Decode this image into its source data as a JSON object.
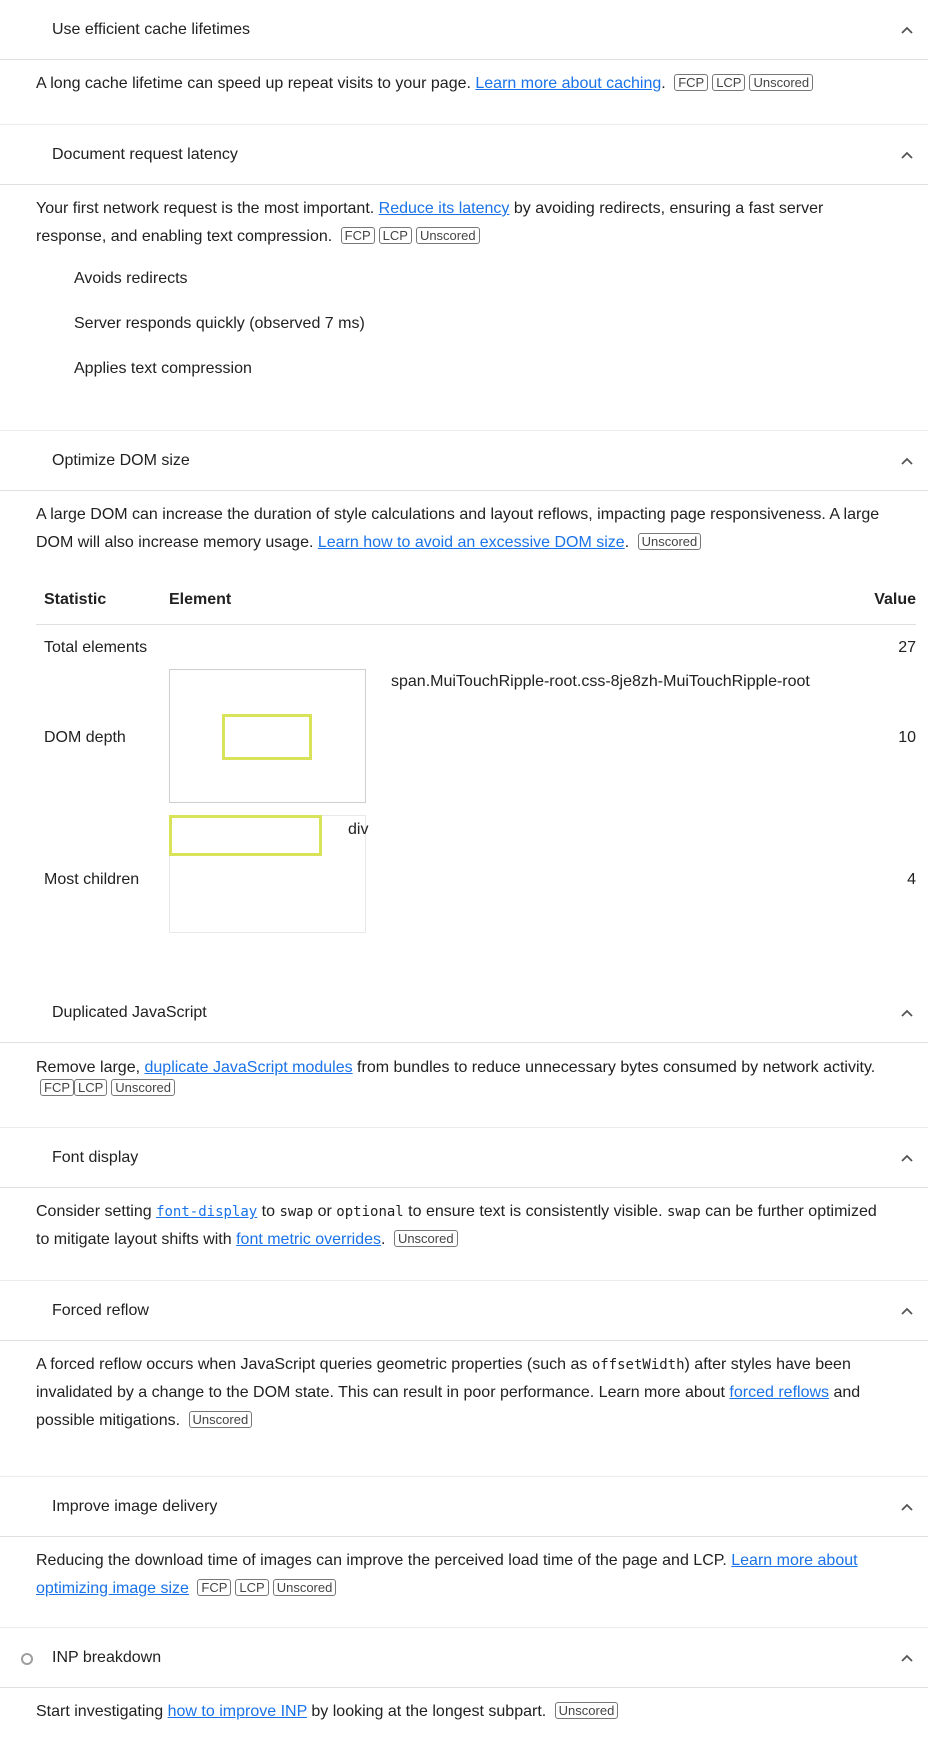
{
  "audits": [
    {
      "title": "Use efficient cache lifetimes",
      "desc_pre": "A long cache lifetime can speed up repeat visits to your page. ",
      "link": "Learn more about caching",
      "desc_post": ".",
      "badges": [
        "FCP",
        "LCP",
        "Unscored"
      ]
    },
    {
      "title": "Document request latency",
      "desc_pre": "Your first network request is the most important. ",
      "link": "Reduce its latency",
      "desc_post": " by avoiding redirects, ensuring a fast server response, and enabling text compression.",
      "badges": [
        "FCP",
        "LCP",
        "Unscored"
      ],
      "checks": [
        "Avoids redirects",
        "Server responds quickly (observed 7 ms)",
        "Applies text compression"
      ]
    },
    {
      "title": "Optimize DOM size",
      "desc_pre": "A large DOM can increase the duration of style calculations and layout reflows, impacting page responsiveness. A large DOM will also increase memory usage. ",
      "link": "Learn how to avoid an excessive DOM size",
      "desc_post": ".",
      "badges": [
        "Unscored"
      ],
      "table": {
        "headers": [
          "Statistic",
          "Element",
          "Value"
        ],
        "rows": [
          {
            "statistic": "Total elements",
            "element": "",
            "value": "27"
          },
          {
            "statistic": "DOM depth",
            "element": "span.MuiTouchRipple-root.css-8je8zh-MuiTouchRipple-root",
            "value": "10"
          },
          {
            "statistic": "Most children",
            "element": "div",
            "value": "4"
          }
        ]
      }
    },
    {
      "title": "Duplicated JavaScript",
      "desc_pre": "Remove large, ",
      "link": "duplicate JavaScript modules",
      "desc_post": " from bundles to reduce unnecessary bytes consumed by network activity.",
      "badges": [
        "FCP",
        "LCP",
        "Unscored"
      ]
    },
    {
      "title": "Font display",
      "desc_1": "Consider setting ",
      "link_code": "font-display",
      "desc_2": " to ",
      "code_1": "swap",
      "desc_3": " or ",
      "code_2": "optional",
      "desc_4": " to ensure text is consistently visible. ",
      "code_3": "swap",
      "desc_5": " can be further optimized to mitigate layout shifts with ",
      "link": "font metric overrides",
      "desc_post": ".",
      "badges": [
        "Unscored"
      ]
    },
    {
      "title": "Forced reflow",
      "desc_1": "A forced reflow occurs when JavaScript queries geometric properties (such as ",
      "code_1": "offsetWidth",
      "desc_2": ") after styles have been invalidated by a change to the DOM state. This can result in poor performance. Learn more about ",
      "link": "forced reflows",
      "desc_post": " and possible mitigations.",
      "badges": [
        "Unscored"
      ]
    },
    {
      "title": "Improve image delivery",
      "desc_pre": "Reducing the download time of images can improve the perceived load time of the page and LCP. ",
      "link": "Learn more about optimizing image size",
      "desc_post": "",
      "badges": [
        "FCP",
        "LCP",
        "Unscored"
      ]
    },
    {
      "title": "INP breakdown",
      "desc_pre": "Start investigating ",
      "link": "how to improve INP",
      "desc_post": " by looking at the longest subpart.",
      "badges": [
        "Unscored"
      ]
    }
  ],
  "colors": {
    "link": "#1a73e8",
    "highlight": "#d8e35a",
    "divider": "#e0e0e0"
  },
  "icons": {
    "expand": "chevron-up-icon",
    "status": "circle-outline-icon"
  }
}
